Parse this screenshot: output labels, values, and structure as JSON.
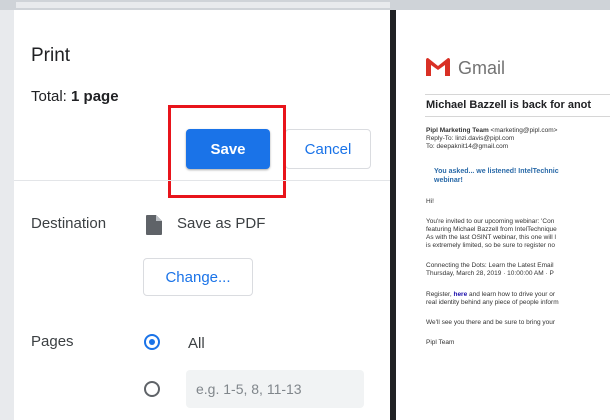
{
  "print_dialog": {
    "title": "Print",
    "total_label": "Total: ",
    "total_value": "1 page",
    "save_label": "Save",
    "cancel_label": "Cancel",
    "destination_label": "Destination",
    "destination_value": "Save as PDF",
    "change_label": "Change...",
    "pages_label": "Pages",
    "pages_all_label": "All",
    "pages_all_selected": true,
    "pages_custom_placeholder": "e.g. 1-5, 8, 11-13",
    "accent_color": "#1a73e8",
    "highlight_color": "#e8141b"
  },
  "preview": {
    "brand": "Gmail",
    "subject": "Michael Bazzell is back for anot",
    "from_name": "Pipl Marketing Team",
    "from_email": "<marketing@pipl.com>",
    "reply_to": "Reply-To: linzi.davis@pipl.com",
    "to": "To: deepaknit14@gmail.com",
    "headline_1": "You asked... we listened! IntelTechnic",
    "headline_2": "webinar!",
    "greeting": "Hi!",
    "para1_line1": "You're invited to our upcoming webinar: 'Con",
    "para1_line2": "featuring Michael Bazzell from IntelTechnique",
    "para1_line3": "As with the last OSINT webinar, this one will l",
    "para1_line4": "is extremely limited, so be sure to register no",
    "event_line1": "Connecting the Dots: Learn the Latest Email",
    "event_line2": "Thursday, March 28, 2019 · 10:00:00 AM · P",
    "register_pre": "Register, ",
    "register_link": "here",
    "register_post": " and learn how to drive your or",
    "register_line2": "real identity behind any piece of people inform",
    "closing": "We'll see you there and be sure to bring your",
    "signoff": "Pipl Team"
  }
}
